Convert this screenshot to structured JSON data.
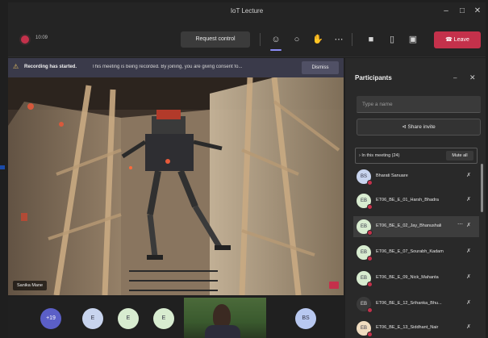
{
  "window": {
    "title": "IoT Lecture"
  },
  "toolbar": {
    "timer": "10:09",
    "request_control": "Request control",
    "leave": "Leave"
  },
  "banner": {
    "bold": "Recording has started.",
    "message": "This meeting is being recorded. By joining, you are giving consent fo...",
    "dismiss": "Dismiss"
  },
  "video": {
    "presenter_name": "Sanika Mane"
  },
  "strip": {
    "overflow_count": "+19",
    "avatars": [
      "E",
      "E",
      "E"
    ],
    "right_avatar": "BS"
  },
  "panel": {
    "title": "Participants",
    "search_placeholder": "Type a name",
    "share_invite": "Share invite",
    "in_meeting": "In this meeting (24)",
    "mute_all": "Mute all",
    "participants": [
      {
        "name": "Bharati Sanuare",
        "initials": "BS"
      },
      {
        "name": "ET06_BE_E_01_Harsh_Bhadra",
        "initials": "EB"
      },
      {
        "name": "ET06_BE_E_02_Jay_Bhanushali",
        "initials": "EB"
      },
      {
        "name": "ET06_BE_E_07_Sourabh_Kadam",
        "initials": "EB"
      },
      {
        "name": "ET06_BE_E_09_Nick_Mahanta",
        "initials": "EB"
      },
      {
        "name": "ET06_BE_E_12_Srihanka_Bhu...",
        "initials": "EB"
      },
      {
        "name": "ET06_BE_E_13_Siddhant_Nair",
        "initials": "EB"
      }
    ]
  }
}
